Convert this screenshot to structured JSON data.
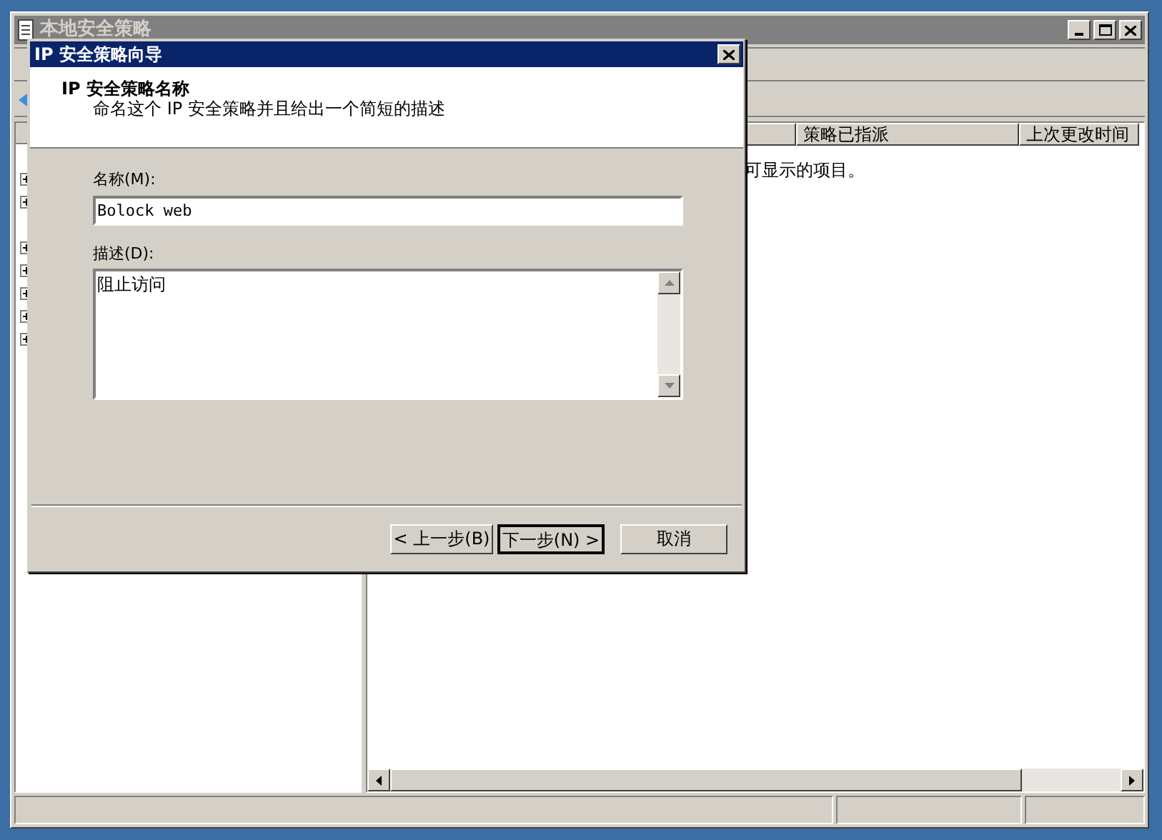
{
  "main_window": {
    "title": "本地安全策略",
    "columns": [
      {
        "label": "策略已指派"
      },
      {
        "label": "上次更改时间"
      }
    ],
    "empty_message": "可显示的项目。"
  },
  "dialog": {
    "title": "IP 安全策略向导",
    "heading": "IP 安全策略名称",
    "subheading": "命名这个 IP 安全策略并且给出一个简短的描述",
    "name_label": "名称(M):",
    "name_value": "Bolock web",
    "description_label": "描述(D):",
    "description_value": "阻止访问",
    "buttons": [
      {
        "label": "< 上一步(B)",
        "default": false
      },
      {
        "label": "下一步(N) >",
        "default": true
      },
      {
        "label": "取消",
        "default": false
      }
    ]
  }
}
